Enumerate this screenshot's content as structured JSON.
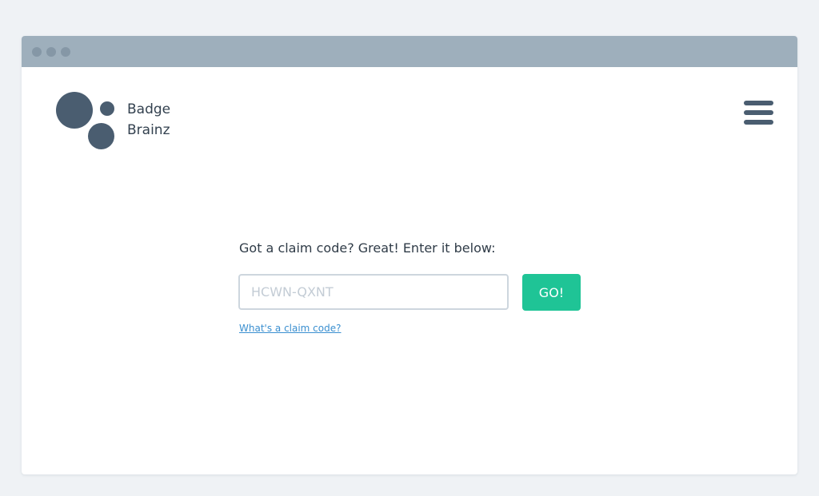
{
  "brand": {
    "line1": "Badge",
    "line2": "Brainz"
  },
  "header": {
    "menu_icon": "hamburger-menu-icon"
  },
  "claim": {
    "prompt": "Got a claim code? Great! Enter it below:",
    "input_placeholder": "HCWN-QXNT",
    "input_value": "",
    "go_label": "GO!",
    "help_link": "What's a claim code?"
  },
  "colors": {
    "page_background": "#eff2f5",
    "titlebar": "#9eafbc",
    "brand_dark": "#4a5d70",
    "accent_green": "#1fc496",
    "link_blue": "#3a8fd0"
  }
}
